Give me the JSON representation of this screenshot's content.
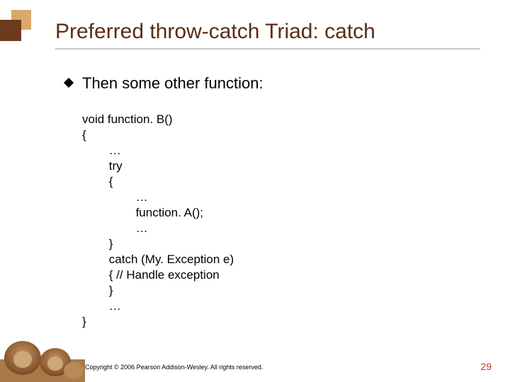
{
  "title": "Preferred throw-catch Triad: catch",
  "bullet": "Then some other function:",
  "code": {
    "l1": "void function. B()",
    "l2": "{",
    "l3": "        …",
    "l4": "        try",
    "l5": "        {",
    "l6": "                …",
    "l7": "                function. A();",
    "l8": "                …",
    "l9": "        }",
    "l10": "        catch (My. Exception e)",
    "l11": "        { // Handle exception",
    "l12": "        }",
    "l13": "        …",
    "l14": "}"
  },
  "copyright": "Copyright © 2006 Pearson Addison-Wesley. All rights reserved.",
  "page_number": "29"
}
